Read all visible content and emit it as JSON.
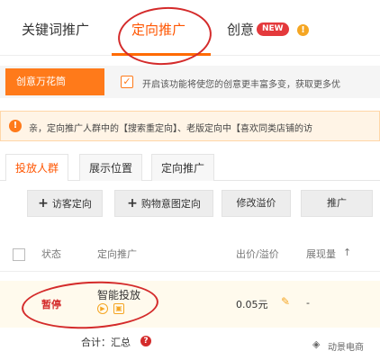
{
  "top_tabs": {
    "keyword": "关键词推广",
    "targeting": "定向推广",
    "creative": "创意",
    "new_badge": "NEW",
    "info": "!"
  },
  "creative_bar": {
    "tag": "创意万花筒",
    "checkbox_checked": true,
    "text": "开启该功能将使您的创意更丰富多变，获取更多优"
  },
  "notice": {
    "icon": "!",
    "text": "亲，定向推广人群中的【搜索重定向】、老版定向中【喜欢同类店铺的访"
  },
  "sub_tabs": [
    "投放人群",
    "展示位置",
    "定向推广"
  ],
  "toolbar": {
    "visitor_btn": "访客定向",
    "intent_btn": "购物意图定向",
    "modify_btn": "修改溢价",
    "promote_btn": "推广"
  },
  "table": {
    "headers": {
      "status": "状态",
      "plan": "定向推广",
      "bid": "出价/溢价",
      "impressions": "展现量",
      "sort_arrow": "↑"
    },
    "row": {
      "status": "暂停",
      "name": "智能投放",
      "price": "0.05元",
      "impressions": "-"
    },
    "total_label": "合计：汇总",
    "help": "?"
  },
  "watermark": {
    "text": "动景电商"
  },
  "colors": {
    "accent": "#ff5500",
    "annotation_red": "#d42b2b",
    "notice_bg": "#fff4e6"
  }
}
